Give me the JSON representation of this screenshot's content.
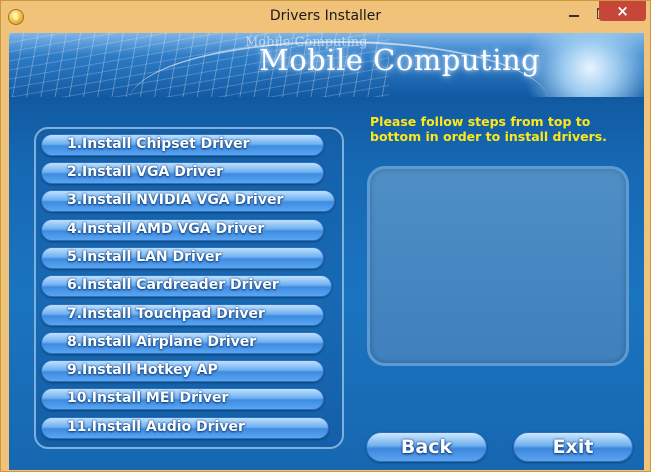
{
  "window": {
    "title": "Drivers Installer",
    "close_glyph": "×",
    "icon": "cd-disc-icon"
  },
  "banner": {
    "small_text": "Mobile Computing",
    "big_text": "Mobile Computing"
  },
  "instruction": "Please follow steps from top to bottom in order to install drivers.",
  "drivers": [
    "1.Install Chipset Driver",
    "2.Install VGA Driver",
    "3.Install NVIDIA VGA Driver",
    "4.Install AMD VGA Driver",
    "5.Install LAN Driver",
    "6.Install Cardreader Driver",
    "7.Install Touchpad Driver",
    "8.Install Airplane Driver",
    "9.Install Hotkey AP",
    "10.Install MEI Driver",
    "11.Install Audio Driver"
  ],
  "buttons": {
    "back": "Back",
    "exit": "Exit"
  },
  "colors": {
    "title_bar": "#f0c27a",
    "close_button": "#c7463a",
    "instruction_text": "#ffe81a",
    "button_blue": "#3f8be0"
  }
}
